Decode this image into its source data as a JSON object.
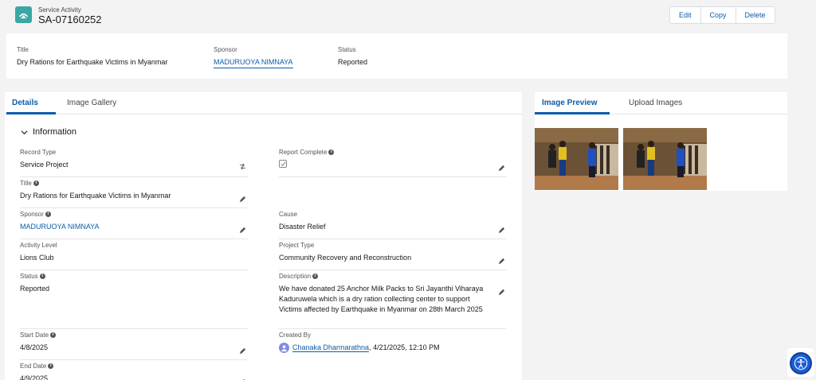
{
  "header": {
    "object_type": "Service Activity",
    "record_name": "SA-07160252",
    "icon": "service-activity-icon",
    "icon_color": "#3ba7a4",
    "actions": [
      "Edit",
      "Copy",
      "Delete"
    ]
  },
  "highlights": {
    "title_label": "Title",
    "title_value": "Dry Rations for Earthquake Victims in Myanmar",
    "sponsor_label": "Sponsor",
    "sponsor_value": "MADURUOYA NIMNAYA",
    "status_label": "Status",
    "status_value": "Reported"
  },
  "main": {
    "tabs": [
      "Details",
      "Image Gallery"
    ],
    "active_tab": "Details",
    "section_title": "Information",
    "fields": {
      "record_type": {
        "label": "Record Type",
        "value": "Service Project"
      },
      "report_complete": {
        "label": "Report Complete",
        "checked": true
      },
      "title": {
        "label": "Title",
        "value": "Dry Rations for Earthquake Victims in Myanmar"
      },
      "sponsor": {
        "label": "Sponsor",
        "value": "MADURUOYA NIMNAYA"
      },
      "cause": {
        "label": "Cause",
        "value": "Disaster Relief"
      },
      "activity_level": {
        "label": "Activity Level",
        "value": "Lions Club"
      },
      "project_type": {
        "label": "Project Type",
        "value": "Community Recovery and Reconstruction"
      },
      "status": {
        "label": "Status",
        "value": "Reported"
      },
      "description": {
        "label": "Description",
        "value": "We have donated 25 Anchor Milk Packs to Sri Jayanthi Viharaya Kaduruwela which is a dry ration collecting center to support Victims affected by Earthquake in Myanmar on 28th March 2025"
      },
      "start_date": {
        "label": "Start Date",
        "value": "4/8/2025"
      },
      "created_by": {
        "label": "Created By",
        "user": "Chanaka Dharmarathna",
        "datetime": ", 4/21/2025, 12:10 PM"
      },
      "end_date": {
        "label": "End Date",
        "value": "4/9/2025"
      }
    }
  },
  "side": {
    "tabs": [
      "Image Preview",
      "Upload Images"
    ],
    "active_tab": "Image Preview"
  },
  "colors": {
    "link": "#0b5cab",
    "accessibility": "#1a5ed6"
  }
}
